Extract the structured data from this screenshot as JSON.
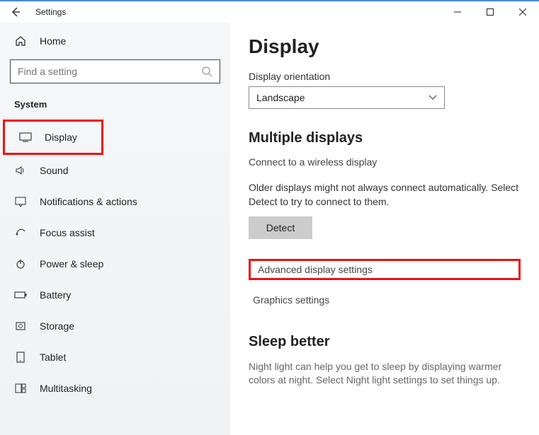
{
  "titlebar": {
    "app_name": "Settings"
  },
  "sidebar": {
    "home_label": "Home",
    "search_placeholder": "Find a setting",
    "category_label": "System",
    "items": [
      {
        "label": "Display"
      },
      {
        "label": "Sound"
      },
      {
        "label": "Notifications & actions"
      },
      {
        "label": "Focus assist"
      },
      {
        "label": "Power & sleep"
      },
      {
        "label": "Battery"
      },
      {
        "label": "Storage"
      },
      {
        "label": "Tablet"
      },
      {
        "label": "Multitasking"
      }
    ]
  },
  "main": {
    "page_title": "Display",
    "orientation_label": "Display orientation",
    "orientation_value": "Landscape",
    "multiple_heading": "Multiple displays",
    "wireless_link": "Connect to a wireless display",
    "detect_desc": "Older displays might not always connect automatically. Select Detect to try to connect to them.",
    "detect_btn": "Detect",
    "adv_link": "Advanced display settings",
    "graphics_link": "Graphics settings",
    "sleep_heading": "Sleep better",
    "sleep_desc": "Night light can help you get to sleep by displaying warmer colors at night. Select Night light settings to set things up."
  }
}
